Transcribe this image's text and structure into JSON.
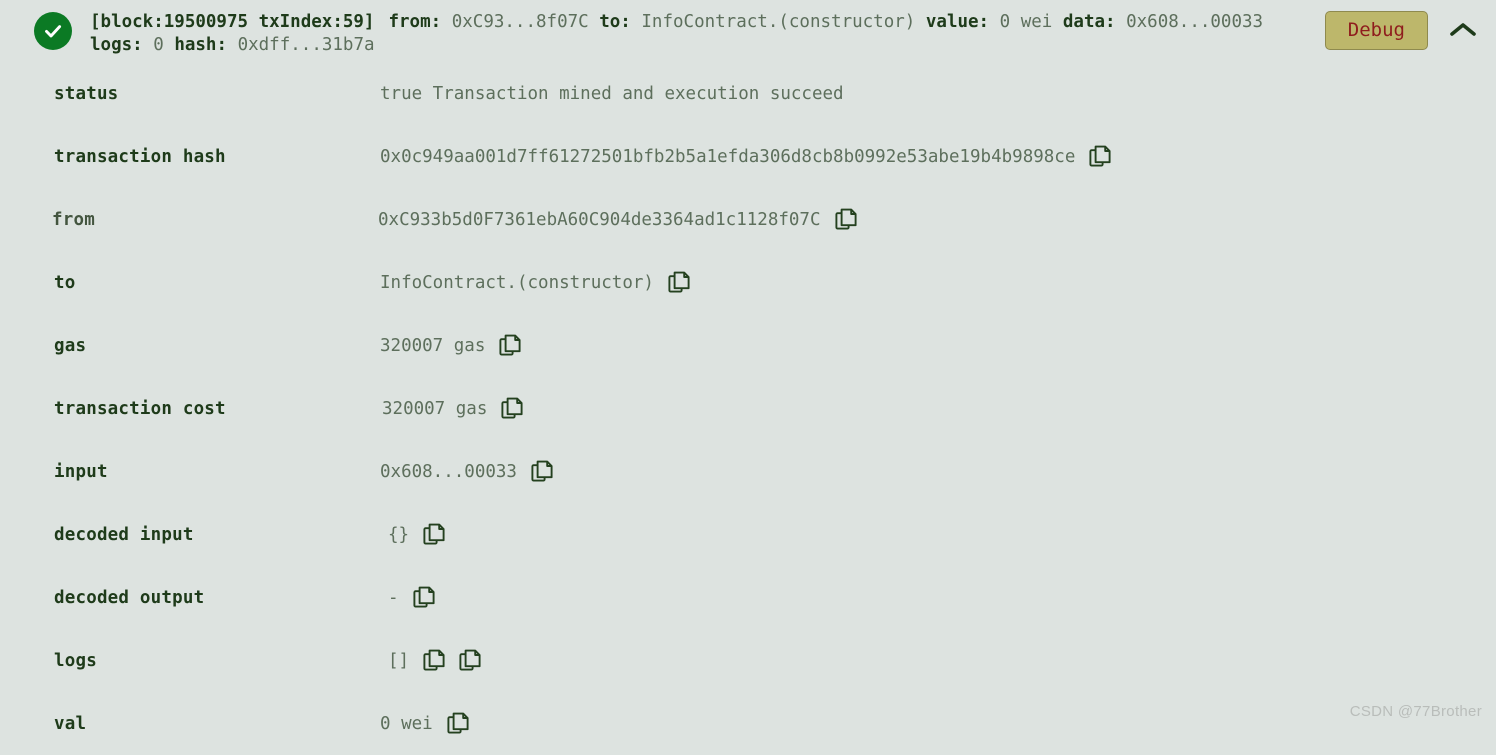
{
  "header": {
    "status_icon": "success-check-icon",
    "summary": {
      "block_tag": "[block:19500975 txIndex:59]",
      "from_label": "from:",
      "from_value": "0xC93...8f07C",
      "to_label": "to:",
      "to_value": "InfoContract.(constructor)",
      "value_label": "value:",
      "value_value": "0 wei",
      "data_label": "data:",
      "data_value": "0x608...00033",
      "logs_label": "logs:",
      "logs_value": "0",
      "hash_label": "hash:",
      "hash_value": "0xdff...31b7a"
    },
    "debug_label": "Debug",
    "collapse_icon": "chevron-up-icon"
  },
  "rows": [
    {
      "label": "status",
      "value": "true Transaction mined and execution succeed",
      "copies": 0,
      "label_style": "bold",
      "indent": 1
    },
    {
      "label": "transaction hash",
      "value": "0x0c949aa001d7ff61272501bfb2b5a1efda306d8cb8b0992e53abe19b4b9898ce",
      "copies": 1,
      "label_style": "bold",
      "indent": 1
    },
    {
      "label": "from",
      "value": "0xC933b5d0F7361ebA60C904de3364ad1c1128f07C",
      "copies": 1,
      "label_style": "light",
      "indent": 1
    },
    {
      "label": "to",
      "value": "InfoContract.(constructor)",
      "copies": 1,
      "label_style": "bold",
      "indent": 1
    },
    {
      "label": "gas",
      "value": "320007 gas",
      "copies": 1,
      "label_style": "bold",
      "indent": 1
    },
    {
      "label": "transaction cost",
      "value": "320007 gas",
      "copies": 1,
      "label_style": "bold",
      "indent": 3
    },
    {
      "label": "input",
      "value": "0x608...00033",
      "copies": 1,
      "label_style": "bold",
      "indent": 1
    },
    {
      "label": "decoded input",
      "value": "{}",
      "copies": 1,
      "label_style": "bold",
      "indent": 2
    },
    {
      "label": "decoded output",
      "value": "-",
      "copies": 1,
      "label_style": "bold",
      "indent": 2
    },
    {
      "label": "logs",
      "value": "[]",
      "copies": 2,
      "label_style": "bold",
      "indent": 2
    },
    {
      "label": "val",
      "value": "0 wei",
      "copies": 1,
      "label_style": "bold",
      "indent": 1
    }
  ],
  "watermark": "CSDN @77Brother",
  "colors": {
    "background": "#dde3e0",
    "label_text": "#1e3b1a",
    "value_text": "#5d6f5c",
    "success_green": "#0b7a24",
    "debug_bg": "#bdb76b",
    "debug_text": "#8f1d1d",
    "watermark": "#b9bdba"
  }
}
